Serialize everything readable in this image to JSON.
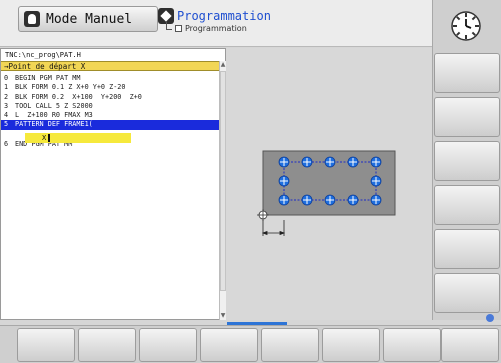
{
  "header": {
    "mode_label": "Mode Manuel",
    "program_label": "Programmation",
    "program_sublabel": "Programmation"
  },
  "editor": {
    "path": "TNC:\\nc_prog\\PAT.H",
    "reference_label": "→Point de départ X",
    "lines": [
      {
        "num": "0",
        "text": "BEGIN PGM PAT MM"
      },
      {
        "num": "1",
        "text": "BLK FORM 0.1 Z X+0 Y+0 Z-20"
      },
      {
        "num": "2",
        "text": "BLK FORM 0.2  X+100  Y+200  Z+0"
      },
      {
        "num": "3",
        "text": "TOOL CALL 5 Z S2000"
      },
      {
        "num": "4",
        "text": "L  Z+100 R0 FMAX M3"
      },
      {
        "num": "5",
        "text": "PATTERN DEF FRAME1("
      },
      {
        "num": "6",
        "text": "END PGM PAT MM"
      }
    ],
    "selected_line": 5,
    "edit_value": "X"
  },
  "colors": {
    "accent": "#1a2bdc",
    "highlight_yellow": "#f2d655",
    "hole_blue": "#1e6fe0"
  },
  "icons": {
    "mode": "hand-icon",
    "program": "program-icon",
    "clock": "clock-icon"
  }
}
